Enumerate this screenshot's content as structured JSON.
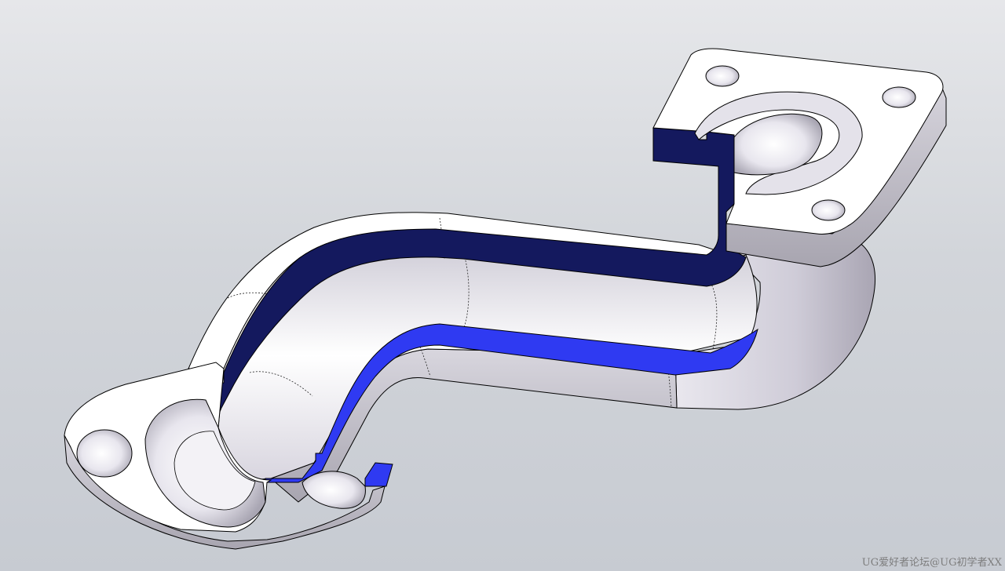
{
  "viewport": {
    "background_top": "#e6e7ea",
    "background_bottom": "#c7cbd2"
  },
  "model": {
    "description_icon": "cad-part-section-view",
    "section_color_dark": "#14195e",
    "section_color_bright": "#2f3af2",
    "edge_color": "#000000"
  },
  "watermark": {
    "text": "UG爱好者论坛@UG初学者XX"
  }
}
